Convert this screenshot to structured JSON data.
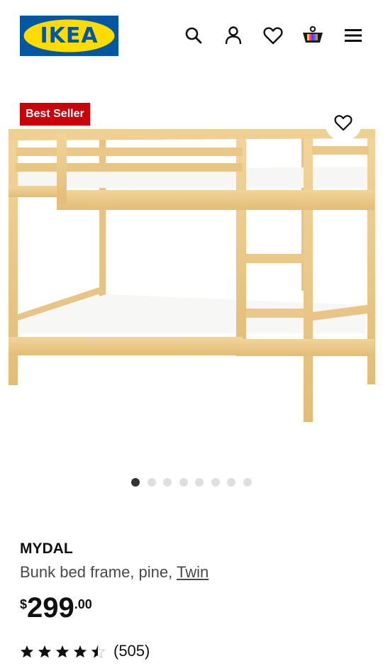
{
  "brand": {
    "logo_text": "IKEA",
    "colors": {
      "blue": "#0058a3",
      "yellow": "#ffdb00"
    }
  },
  "header": {
    "icons": [
      "search-icon",
      "account-icon",
      "favorites-icon",
      "cart-icon",
      "menu-icon"
    ]
  },
  "product": {
    "badge": "Best Seller",
    "badge_color": "#cc0008",
    "name": "MYDAL",
    "description_prefix": "Bunk bed frame, pine, ",
    "size": "Twin",
    "price": {
      "currency": "$",
      "integer": "299",
      "decimal": ".00"
    },
    "rating": {
      "value": 4.5,
      "max": 5,
      "count_text": "(505)"
    }
  },
  "carousel": {
    "total": 8,
    "active": 1
  }
}
